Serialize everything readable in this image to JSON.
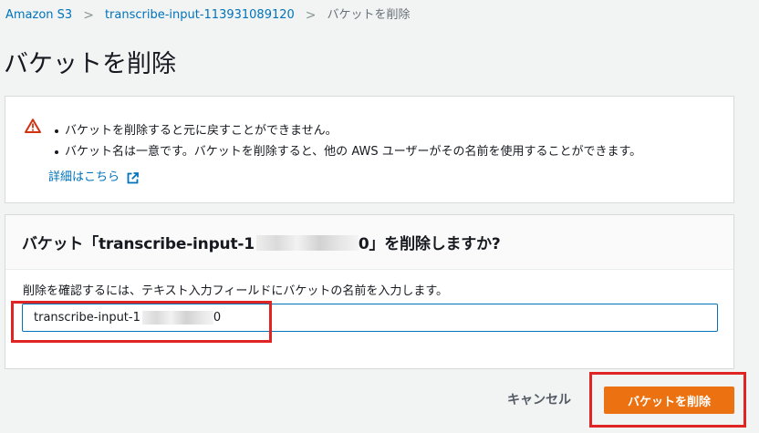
{
  "breadcrumb": {
    "items": [
      "Amazon S3",
      "transcribe-input-113931089120",
      "バケットを削除"
    ],
    "separator": ">"
  },
  "page": {
    "title": "バケットを削除"
  },
  "warning": {
    "icon": "warning-triangle-icon",
    "bullets": [
      "バケットを削除すると元に戻すことができません。",
      "バケット名は一意です。バケットを削除すると、他の AWS ユーザーがその名前を使用することができます。"
    ],
    "learn_more": "詳細はこちら",
    "learn_more_icon": "external-link-icon"
  },
  "confirm": {
    "title_prefix": "バケット「transcribe-input-1",
    "title_suffix": "0」を削除しますか?",
    "help": "削除を確認するには、テキスト入力フィールドにバケットの名前を入力します。",
    "input_value_prefix": "transcribe-input-1",
    "input_value_suffix": "0"
  },
  "actions": {
    "cancel": "キャンセル",
    "delete": "バケットを削除"
  },
  "colors": {
    "link": "#0073bb",
    "primary_button": "#ec7211",
    "warning": "#d13212",
    "highlight": "#e02424",
    "background": "#f2f3f3"
  }
}
